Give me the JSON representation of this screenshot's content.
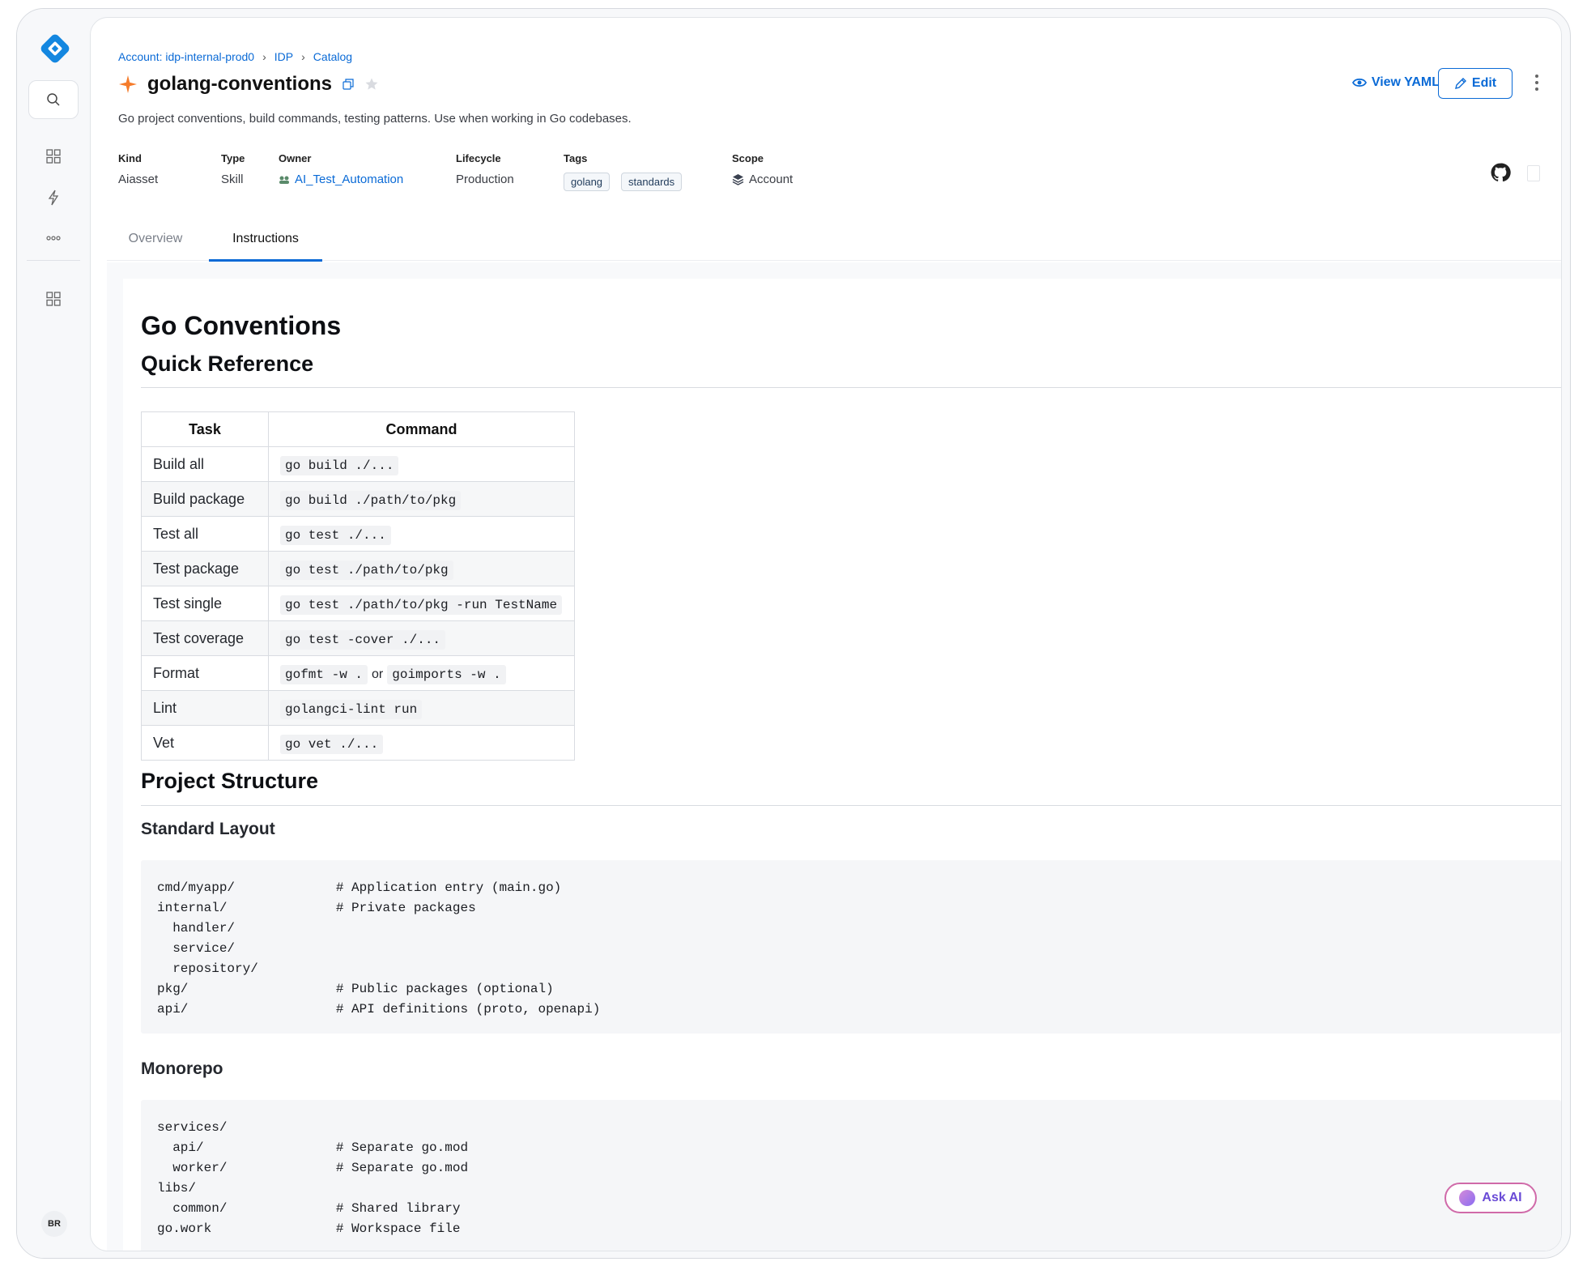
{
  "breadcrumb": [
    {
      "label": "Account: idp-internal-prod0"
    },
    {
      "label": "IDP"
    },
    {
      "label": "Catalog"
    }
  ],
  "header": {
    "title": "golang-conventions",
    "description": "Go project conventions, build commands, testing patterns. Use when working in Go codebases.",
    "view_yaml_label": "View YAML",
    "edit_label": "Edit"
  },
  "meta": {
    "kind": {
      "label": "Kind",
      "value": "Aiasset"
    },
    "type": {
      "label": "Type",
      "value": "Skill"
    },
    "owner": {
      "label": "Owner",
      "value": "AI_Test_Automation"
    },
    "lifecycle": {
      "label": "Lifecycle",
      "value": "Production"
    },
    "tags": {
      "label": "Tags",
      "values": [
        "golang",
        "standards"
      ]
    },
    "scope": {
      "label": "Scope",
      "value": "Account"
    }
  },
  "tabs": [
    {
      "label": "Overview",
      "active": false
    },
    {
      "label": "Instructions",
      "active": true
    }
  ],
  "doc": {
    "h1": "Go Conventions",
    "quick_reference": {
      "heading": "Quick Reference",
      "columns": [
        "Task",
        "Command"
      ],
      "rows": [
        {
          "task": "Build all",
          "command": "go build ./..."
        },
        {
          "task": "Build package",
          "command": "go build ./path/to/pkg"
        },
        {
          "task": "Test all",
          "command": "go test ./..."
        },
        {
          "task": "Test package",
          "command": "go test ./path/to/pkg"
        },
        {
          "task": "Test single",
          "command": "go test ./path/to/pkg -run TestName"
        },
        {
          "task": "Test coverage",
          "command": "go test -cover ./..."
        },
        {
          "task": "Format",
          "command": "gofmt -w .",
          "or": "or",
          "command2": "goimports -w ."
        },
        {
          "task": "Lint",
          "command": "golangci-lint run"
        },
        {
          "task": "Vet",
          "command": "go vet ./..."
        }
      ]
    },
    "project_structure": {
      "heading": "Project Structure",
      "standard_layout": {
        "heading": "Standard Layout",
        "lines": [
          "cmd/myapp/             # Application entry (main.go)",
          "internal/              # Private packages",
          "  handler/",
          "  service/",
          "  repository/",
          "pkg/                   # Public packages (optional)",
          "api/                   # API definitions (proto, openapi)"
        ]
      },
      "monorepo": {
        "heading": "Monorepo",
        "lines": [
          "services/",
          "  api/                 # Separate go.mod",
          "  worker/              # Separate go.mod",
          "libs/",
          "  common/              # Shared library",
          "go.work                # Workspace file"
        ]
      }
    }
  },
  "user": {
    "initials": "BR"
  },
  "ask_ai_label": "Ask AI",
  "colors": {
    "accent": "#0a6ad6",
    "star_icon": "#f57c2b"
  }
}
